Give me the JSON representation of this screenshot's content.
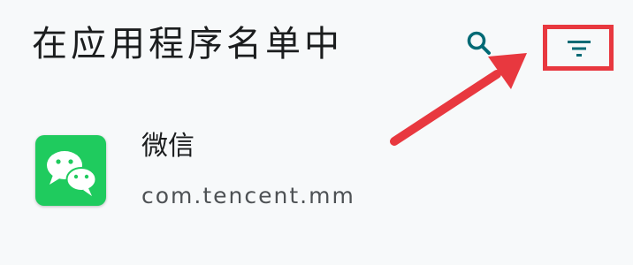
{
  "header": {
    "title": "在应用程序名单中",
    "search_icon": "search-icon",
    "filter_icon": "filter-icon"
  },
  "apps": [
    {
      "name": "微信",
      "package": "com.tencent.mm",
      "icon": "wechat-icon"
    }
  ],
  "colors": {
    "background": "#f7f9fa",
    "accent": "#006a75",
    "highlight": "#e8383f",
    "app_icon_bg": "#1fcb5e"
  }
}
